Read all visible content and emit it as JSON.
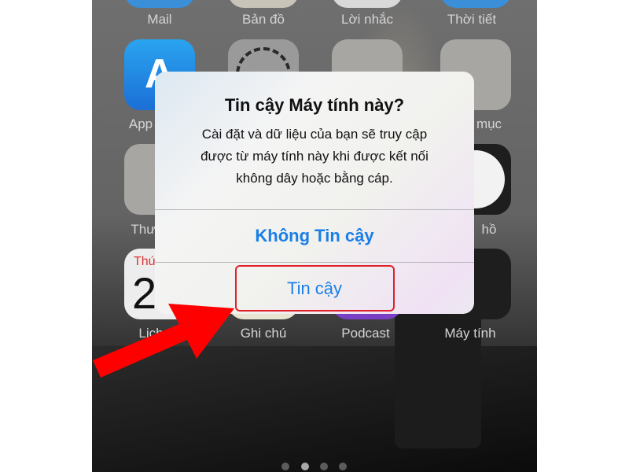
{
  "home": {
    "row0_labels": [
      "Mail",
      "Bản đồ",
      "Lời nhắc",
      "Thời tiết"
    ],
    "row1_labels": [
      "App",
      "mục"
    ],
    "row2_labels": [
      "Thư",
      "hồ"
    ],
    "row3_labels": [
      "Lịch",
      "Ghi chú",
      "Podcast",
      "Máy tính"
    ],
    "calendar_day": "Thứ",
    "calendar_date": "2",
    "page_dots": 4,
    "active_page": 2
  },
  "dialog": {
    "title": "Tin cậy Máy tính này?",
    "message_lines": [
      "Cài đặt và dữ liệu của bạn sẽ truy cập",
      "được từ máy tính này khi được kết nối",
      "không dây hoặc bằng cáp."
    ],
    "dont_trust_label": "Không Tin cậy",
    "trust_label": "Tin cậy"
  },
  "colors": {
    "accent": "#1a7fe6",
    "annotation": "#ff0000"
  },
  "annotation": {
    "type": "arrow",
    "target": "trust-button"
  }
}
